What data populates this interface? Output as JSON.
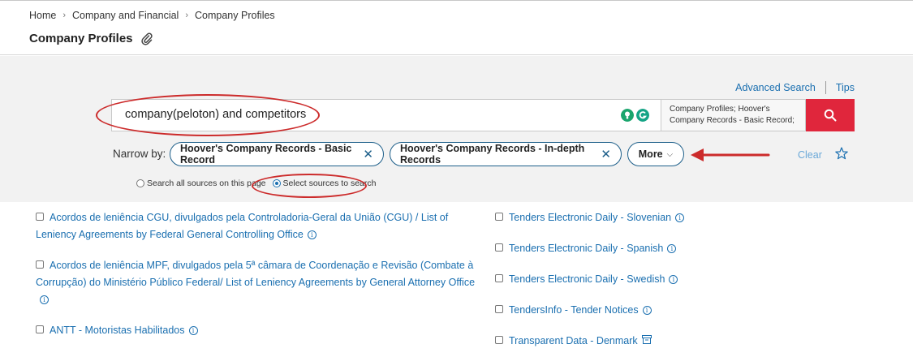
{
  "breadcrumb": {
    "home": "Home",
    "section": "Company and Financial",
    "current": "Company Profiles"
  },
  "page_title": "Company Profiles",
  "links": {
    "advanced_search": "Advanced Search",
    "tips": "Tips"
  },
  "search": {
    "value": "company(peloton) and competitors",
    "sources": "Company Profiles; Hoover's Company Records - Basic Record;"
  },
  "narrow_by": {
    "label": "Narrow by:",
    "chips": [
      "Hoover's Company Records - Basic Record",
      "Hoover's Company Records - In-depth Records"
    ],
    "more": "More",
    "clear": "Clear"
  },
  "scope": {
    "all_sources": "Search all sources on this page",
    "select_sources": "Select sources to search",
    "selected": "select_sources"
  },
  "left_sources": [
    "Acordos de leniência CGU, divulgados pela Controladoria-Geral da União (CGU) / List of Leniency Agreements by Federal General Controlling Office",
    "Acordos de leniência MPF, divulgados pela 5ª câmara de Coordenação e Revisão (Combate à Corrupção) do Ministério Público Federal/ List of Leniency Agreements by General Attorney Office",
    "ANTT - Motoristas Habilitados"
  ],
  "right_sources": [
    "Tenders Electronic Daily - Slovenian",
    "Tenders Electronic Daily - Spanish",
    "Tenders Electronic Daily - Swedish",
    "TendersInfo - Tender Notices",
    "Transparent Data - Denmark"
  ],
  "colors": {
    "link": "#1a6fb0",
    "search_button": "#e0263c",
    "chip_border": "#1d5f8a",
    "annotation": "#cc2b2b"
  }
}
